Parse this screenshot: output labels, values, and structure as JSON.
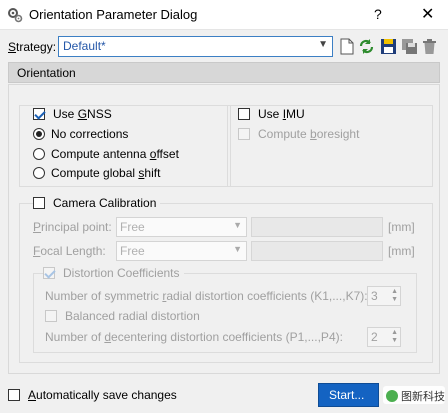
{
  "window": {
    "title": "Orientation Parameter Dialog",
    "help_glyph": "?",
    "close_glyph": "✕"
  },
  "strategy": {
    "label": "Strategy:",
    "value": "Default*",
    "toolbar_icons": [
      "new-document-icon",
      "refresh-icon",
      "save-icon",
      "save-as-icon",
      "delete-icon"
    ]
  },
  "section": {
    "title": "Orientation"
  },
  "gnss": {
    "label": "Use GNSS",
    "checked": true,
    "options": [
      {
        "label": "No corrections",
        "selected": true
      },
      {
        "label": "Compute antenna offset",
        "selected": false
      },
      {
        "label": "Compute global shift",
        "selected": false
      }
    ]
  },
  "imu": {
    "label": "Use IMU",
    "checked": false,
    "boresight_label": "Compute boresight"
  },
  "camera": {
    "label": "Camera Calibration",
    "checked": false,
    "principal_point_label": "Principal point:",
    "principal_point_mode": "Free",
    "principal_point_unit": "[mm]",
    "focal_length_label": "Focal Length:",
    "focal_length_mode": "Free",
    "focal_length_unit": "[mm]",
    "distortion_label": "Distortion Coefficients",
    "symmetric_label": "Number of symmetric radial distortion coefficients (K1,...,K7):",
    "symmetric_value": "3",
    "balanced_label": "Balanced radial distortion",
    "decentering_label": "Number of decentering distortion coefficients (P1,...,P4):",
    "decentering_value": "2"
  },
  "footer": {
    "autosave_label": "Automatically save changes",
    "start_label": "Start...",
    "watermark": "图新科技"
  },
  "colors": {
    "accent": "#1463c2",
    "check_mark": "#1a5fb4",
    "section_bg": "#d7d7d7",
    "disabled_text": "#a0a0a0"
  }
}
